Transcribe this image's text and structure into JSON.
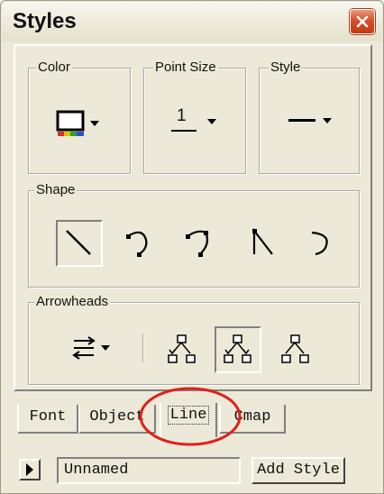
{
  "window": {
    "title": "Styles",
    "close_icon": "close-icon"
  },
  "groups": {
    "color": {
      "label": "Color"
    },
    "point_size": {
      "label": "Point Size",
      "value": "1"
    },
    "style": {
      "label": "Style"
    },
    "shape": {
      "label": "Shape"
    },
    "arrowheads": {
      "label": "Arrowheads"
    }
  },
  "shape_buttons": [
    {
      "name": "straight-line-icon",
      "selected": true
    },
    {
      "name": "curve-left-icon",
      "selected": false
    },
    {
      "name": "curve-right-icon",
      "selected": false
    },
    {
      "name": "angled-line-icon",
      "selected": false
    },
    {
      "name": "arc-icon",
      "selected": false
    }
  ],
  "arrowhead_buttons": [
    {
      "name": "arrowhead-direction-icon",
      "selected": false
    },
    {
      "name": "arrow-tree-left-icon",
      "selected": false
    },
    {
      "name": "arrow-tree-center-icon",
      "selected": true
    },
    {
      "name": "arrow-tree-right-icon",
      "selected": false
    }
  ],
  "tabs": [
    {
      "label": "Font",
      "active": false
    },
    {
      "label": "Object",
      "active": false
    },
    {
      "label": "Line",
      "active": true
    },
    {
      "label": "Cmap",
      "active": false
    }
  ],
  "bottom": {
    "style_name": "Unnamed",
    "add_style_label": "Add Style"
  },
  "colors": {
    "window_bg": "#ece9d8",
    "close_button": "#d9502b",
    "highlight_ellipse": "#e0201a"
  }
}
